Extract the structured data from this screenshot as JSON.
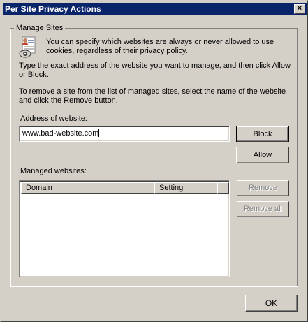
{
  "window": {
    "title": "Per Site Privacy Actions",
    "close_glyph": "×"
  },
  "group": {
    "legend": "Manage Sites",
    "icon": "privacy-settings-icon",
    "intro": "You can specify which websites are always or never allowed to use cookies, regardless of their privacy policy.",
    "instructions": "Type the exact address of the website you want to manage, and then click Allow or Block.",
    "remove_instructions": "To remove a site from the list of managed sites, select the name of the website and click the Remove button."
  },
  "address": {
    "label": "Address of website:",
    "value": "www.bad-website.com"
  },
  "buttons": {
    "block": "Block",
    "allow": "Allow",
    "remove": "Remove",
    "remove_all": "Remove all",
    "ok": "OK"
  },
  "managed": {
    "label": "Managed websites:",
    "columns": [
      "Domain",
      "Setting"
    ],
    "rows": []
  },
  "colors": {
    "title_bar": "#0a246a",
    "face": "#d4d0c8",
    "disabled_text": "#808080"
  }
}
